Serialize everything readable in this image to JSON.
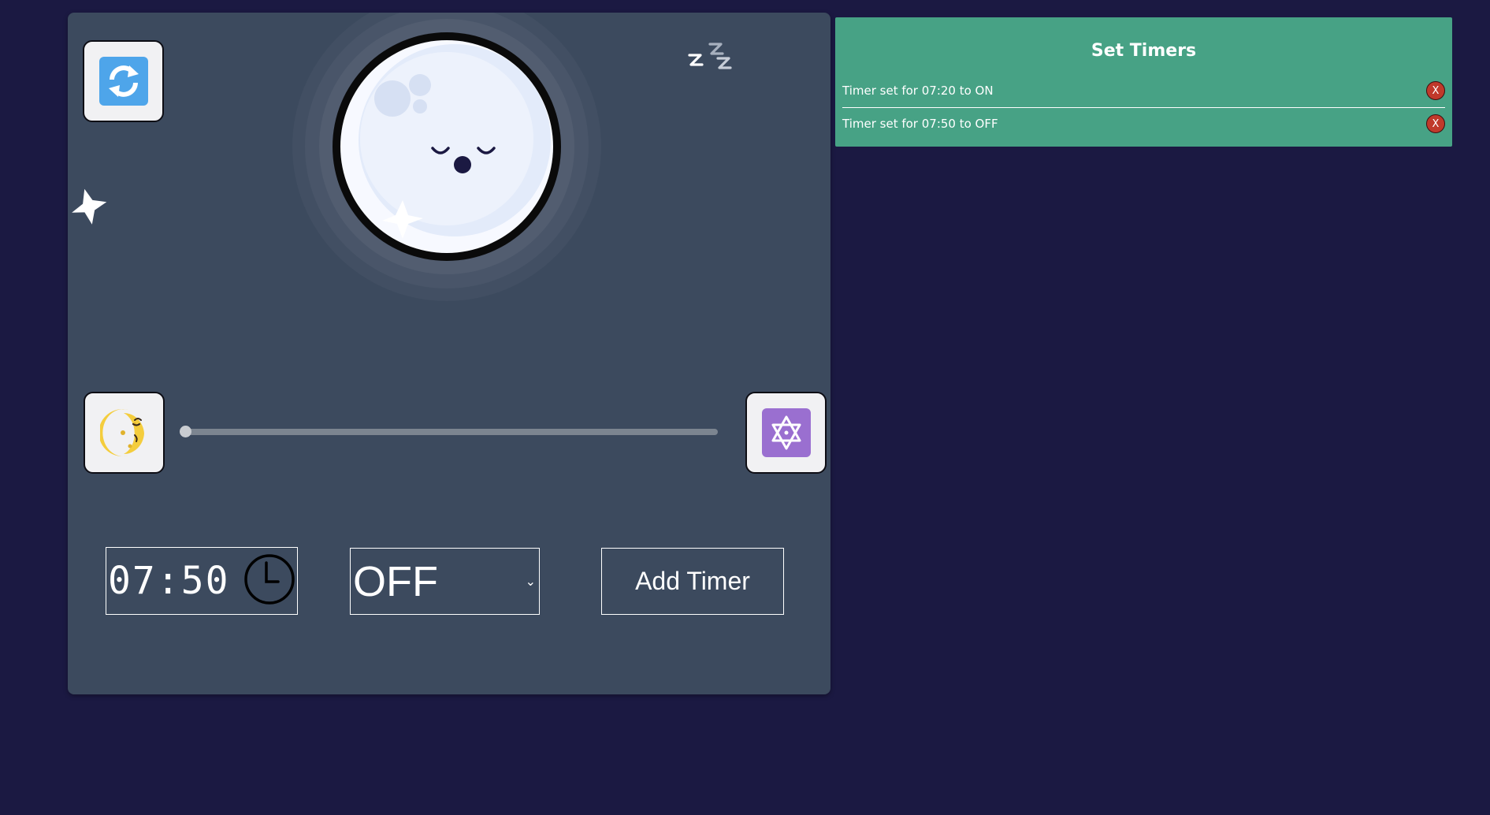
{
  "controls": {
    "refresh_icon": "refresh-icon",
    "night_mode_icon": "crescent-moon-emoji",
    "special_mode_icon": "star-of-david-icon",
    "brightness_slider": {
      "value": 0
    },
    "time_value": "07:50",
    "mode_value": "OFF",
    "add_button_label": "Add Timer"
  },
  "timers": {
    "title": "Set Timers",
    "items": [
      {
        "text": "Timer set for 07:20 to ON",
        "delete_label": "X"
      },
      {
        "text": "Timer set for 07:50 to OFF",
        "delete_label": "X"
      }
    ]
  },
  "colors": {
    "page_bg": "#1b1942",
    "panel_bg": "#3c4a5e",
    "timers_bg": "#47a285",
    "delete_red": "#c0392b",
    "refresh_blue": "#4ea5ea",
    "star_purple": "#9a6fd0"
  }
}
